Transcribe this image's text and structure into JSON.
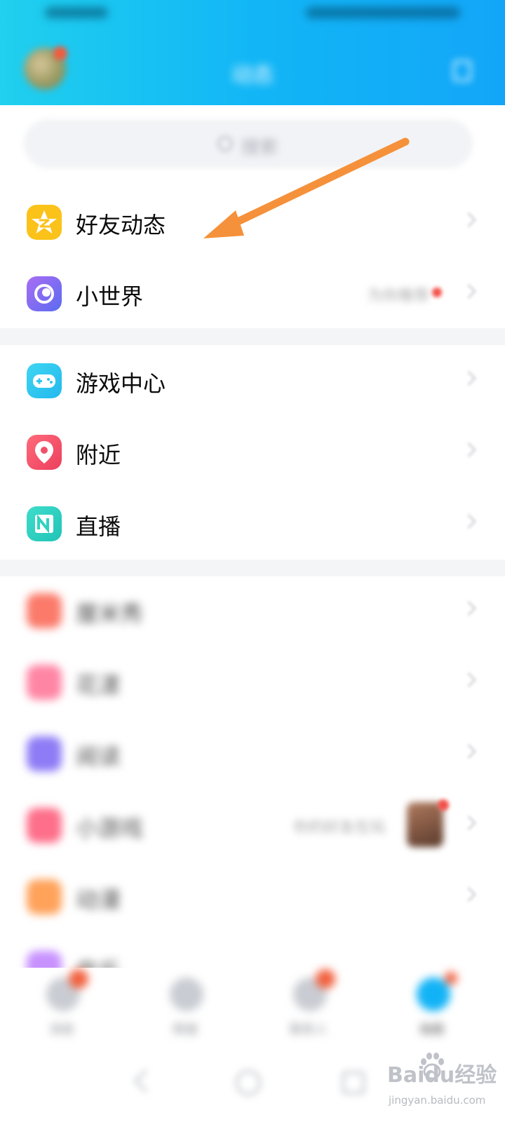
{
  "header": {
    "title": "动态",
    "accent_gradient": [
      "#20d0ee",
      "#13a6f8"
    ]
  },
  "search": {
    "placeholder": "搜索"
  },
  "groups": [
    {
      "items": [
        {
          "label": "好友动态",
          "icon": "qzone-star-icon",
          "color": "#fbc21a"
        },
        {
          "label": "小世界",
          "icon": "planet-icon",
          "color": "#7a6df2",
          "extra_text": "为你推荐",
          "red_dot": true
        }
      ]
    },
    {
      "items": [
        {
          "label": "游戏中心",
          "icon": "gamepad-icon",
          "color": "#2fc6ef"
        },
        {
          "label": "附近",
          "icon": "location-pin-icon",
          "color": "#f2506a"
        },
        {
          "label": "直播",
          "icon": "live-n-icon",
          "color": "#2fd3c0"
        }
      ]
    },
    {
      "items": [
        {
          "label": "厘米秀",
          "icon": "cmshow-icon",
          "color": "#fb7a6a"
        },
        {
          "label": "花漾",
          "icon": "flower-icon",
          "color": "#ff85a4"
        },
        {
          "label": "阅读",
          "icon": "book-icon",
          "color": "#8e7cf6"
        },
        {
          "label": "小游戏",
          "icon": "mini-game-icon",
          "color": "#fd6f8a",
          "extra_text": "你的好友在玩"
        },
        {
          "label": "动漫",
          "icon": "comic-icon",
          "color": "#ffa25a"
        },
        {
          "label": "音乐",
          "icon": "music-icon",
          "color": "#c791ff"
        }
      ]
    }
  ],
  "tabbar": {
    "tabs": [
      {
        "label": "消息",
        "badge": true
      },
      {
        "label": "频道",
        "badge": false
      },
      {
        "label": "联系人",
        "badge": true
      },
      {
        "label": "动态",
        "badge": true,
        "active": true
      }
    ]
  },
  "watermark": {
    "logo_text": "Baidu经验",
    "url": "jingyan.baidu.com"
  },
  "annotation": {
    "arrow_color": "#f5913a"
  }
}
